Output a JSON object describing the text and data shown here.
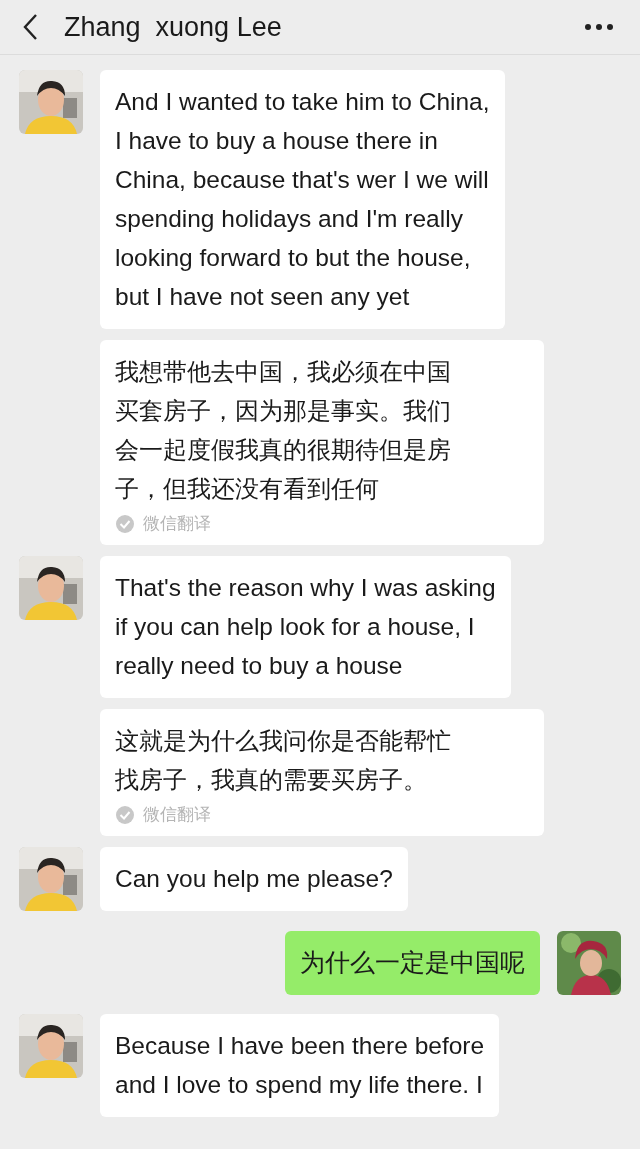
{
  "header": {
    "title": "Zhang  xuong Lee"
  },
  "messages": [
    {
      "kind": "received",
      "lines": [
        "And I wanted to take him to China,",
        "I have to buy a house there in",
        "China, because that's wer I we will",
        "spending holidays and I'm really",
        "looking forward to but the house,",
        "but I have not seen any yet"
      ]
    },
    {
      "kind": "translation",
      "lines": [
        "我想带他去中国，我必须在中国",
        "买套房子，因为那是事实。我们",
        "会一起度假我真的很期待但是房",
        "子，但我还没有看到任何"
      ],
      "label": "微信翻译"
    },
    {
      "kind": "received",
      "lines": [
        "That's the reason why I was asking",
        "if you can help look for a house, I",
        "really need to buy a house"
      ]
    },
    {
      "kind": "translation",
      "lines": [
        "这就是为什么我问你是否能帮忙",
        "找房子，我真的需要买房子。"
      ],
      "label": "微信翻译"
    },
    {
      "kind": "received",
      "lines": [
        "Can you help me please?"
      ]
    },
    {
      "kind": "sent",
      "lines": [
        "为什么一定是中国呢"
      ]
    },
    {
      "kind": "received",
      "lines": [
        "Because I have been there before",
        "and I love to spend my life there. I"
      ]
    }
  ]
}
